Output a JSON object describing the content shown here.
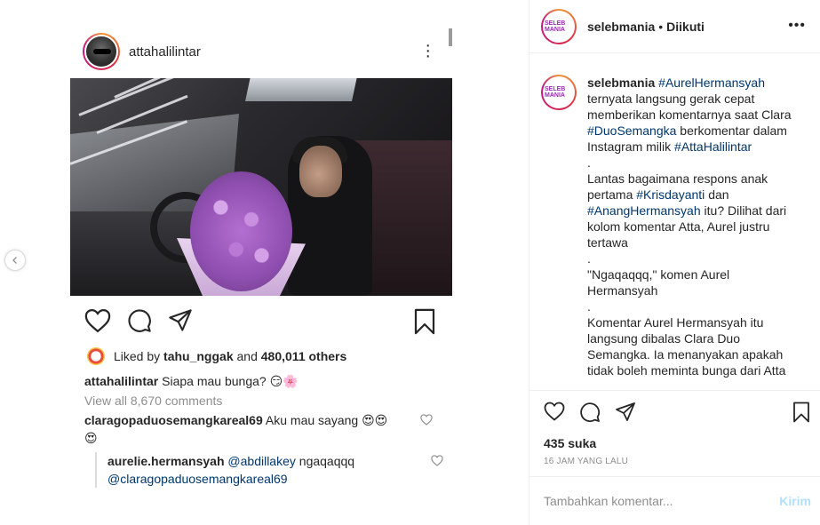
{
  "embedded_post": {
    "username": "attahalilintar",
    "liked_by_prefix": "Liked by",
    "liked_by_user": "tahu_nggak",
    "liked_by_and": "and",
    "liked_by_others": "480,011 others",
    "caption_user": "attahalilintar",
    "caption_text": "Siapa mau bunga? 😏🌸",
    "view_comments": "View all 8,670 comments",
    "comment1_user": "claragopaduosemangkareal69",
    "comment1_text": "Aku mau sayang 😍😍",
    "comment1_text2": "😍",
    "reply_user": "aurelie.hermansyah",
    "reply_mention1": "@abdillakey",
    "reply_text": "ngaqaqqq",
    "reply_mention2": "@claragopaduosemangkareal69"
  },
  "header": {
    "avatar_text": "SELEB MANIA",
    "username": "selebmania",
    "separator": "•",
    "follow_status": "Diikuti"
  },
  "caption": {
    "username": "selebmania",
    "tag1": "#AurelHermansyah",
    "line1": "ternyata langsung gerak cepat memberikan komentarnya saat Clara",
    "tag2": "#DuoSemangka",
    "line2": "berkomentar dalam Instagram milik",
    "tag3": "#AttaHalilintar",
    "dot1": ".",
    "line3": "Lantas bagaimana respons anak pertama",
    "tag4": "#Krisdayanti",
    "line3b": "dan",
    "tag5": "#AnangHermansyah",
    "line4": "itu? Dilihat dari kolom komentar Atta, Aurel justru tertawa",
    "dot2": ".",
    "line5": "\"Ngaqaqqq,\" komen Aurel Hermansyah",
    "dot3": ".",
    "line6": "Komentar Aurel Hermansyah itu langsung dibalas Clara Duo Semangka. Ia menanyakan apakah tidak boleh meminta bunga dari Atta"
  },
  "stats": {
    "likes": "435 suka",
    "time_ago": "16 JAM YANG LALU"
  },
  "comment_box": {
    "placeholder": "Tambahkan komentar...",
    "post_label": "Kirim"
  },
  "colors": {
    "link": "#00376b",
    "muted": "#8e8e8e",
    "post_disabled": "#b2dffc",
    "border": "#efefef"
  }
}
